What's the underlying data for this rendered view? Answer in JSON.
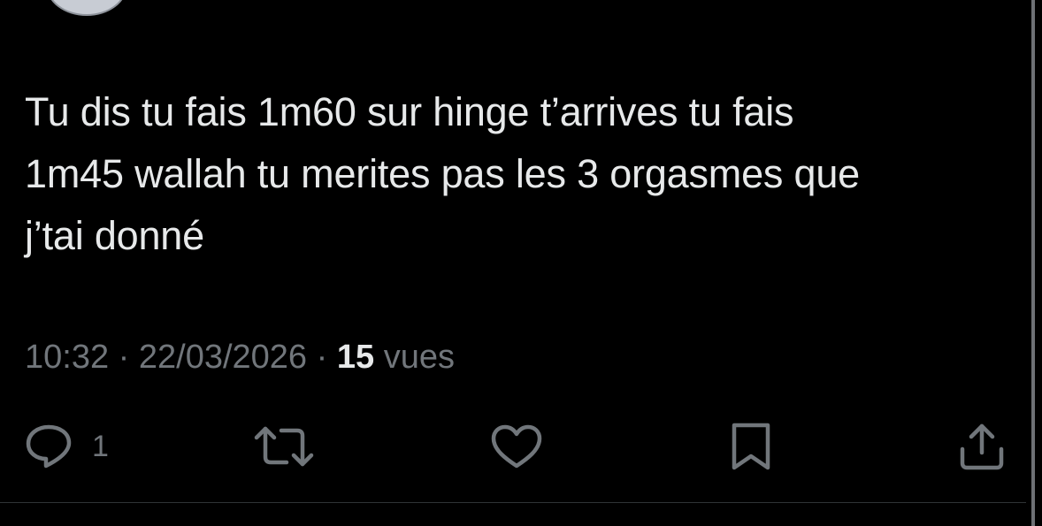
{
  "tweet": {
    "text": "Tu dis tu fais 1m60 sur hinge t’arrives tu fais\n1m45 wallah tu merites pas les 3 orgasmes que\nj’tai donné",
    "time": "10:32",
    "separator": "·",
    "date": "22/03/2026",
    "views_count": "15",
    "views_label": "vues"
  },
  "actions": {
    "reply_icon": "reply-icon",
    "reply_count": "1",
    "retweet_icon": "retweet-icon",
    "like_icon": "heart-icon",
    "bookmark_icon": "bookmark-icon",
    "share_icon": "share-icon"
  },
  "colors": {
    "background": "#000000",
    "text": "#e7e9ea",
    "muted": "#71767b",
    "divider": "#2f3336"
  }
}
